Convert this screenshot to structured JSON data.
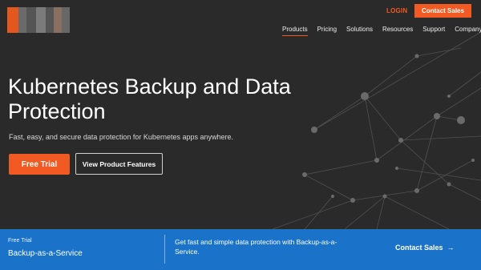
{
  "colors": {
    "accent": "#f15a22",
    "banner": "#1a73c8",
    "hero_bg": "#2a2a2a"
  },
  "header": {
    "logo_colors": [
      "#e4571f",
      "#6a6a6a",
      "#555555",
      "#7b7b7b",
      "#555555",
      "#8a7060",
      "#676767"
    ],
    "login_label": "LOGIN",
    "contact_label": "Contact Sales",
    "nav": [
      {
        "label": "Products",
        "active": true
      },
      {
        "label": "Pricing",
        "active": false
      },
      {
        "label": "Solutions",
        "active": false
      },
      {
        "label": "Resources",
        "active": false
      },
      {
        "label": "Support",
        "active": false
      },
      {
        "label": "Company",
        "active": false
      }
    ]
  },
  "hero": {
    "title": "Kubernetes Backup and Data Protection",
    "subtitle": "Fast, easy, and secure data protection for Kubernetes apps anywhere.",
    "primary_cta": "Free Trial",
    "secondary_cta": "View Product Features"
  },
  "banner": {
    "eyebrow": "Free Trial",
    "product": "Backup-as-a-Service",
    "description": "Get fast and simple data protection with Backup-as-a-Service.",
    "cta_label": "Contact Sales",
    "cta_icon": "arrow-right-icon"
  }
}
